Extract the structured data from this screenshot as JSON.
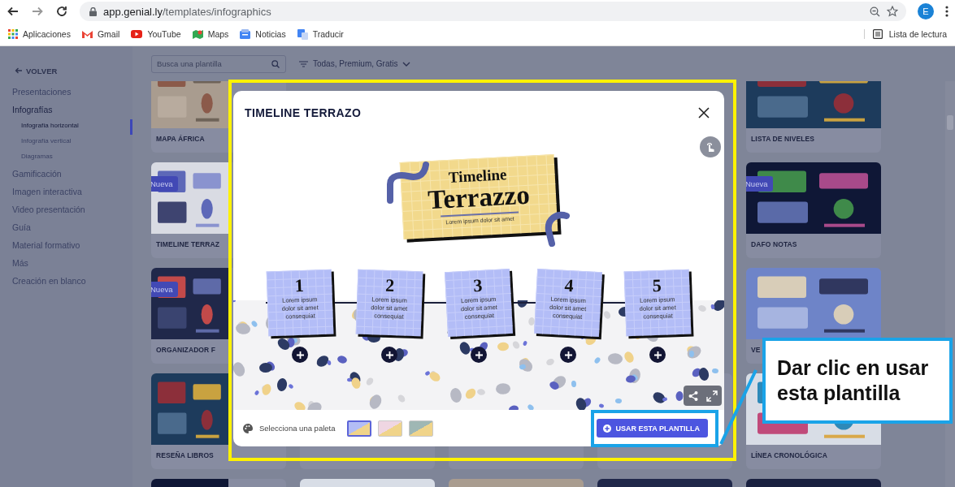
{
  "browser": {
    "url_host": "app.genial.ly",
    "url_path": "/templates/infographics",
    "avatar": "E",
    "bookmarks": [
      {
        "label": "Aplicaciones",
        "kind": "apps"
      },
      {
        "label": "Gmail",
        "kind": "gmail"
      },
      {
        "label": "YouTube",
        "kind": "youtube"
      },
      {
        "label": "Maps",
        "kind": "maps"
      },
      {
        "label": "Noticias",
        "kind": "news"
      },
      {
        "label": "Traducir",
        "kind": "translate"
      }
    ],
    "reading_list": "Lista de lectura"
  },
  "sidebar": {
    "back": "VOLVER",
    "items": [
      {
        "label": "Presentaciones",
        "selected": false
      },
      {
        "label": "Infografías",
        "selected": true,
        "children": [
          {
            "label": "Infografía horizontal",
            "selected": true
          },
          {
            "label": "Infografía vertical",
            "selected": false
          },
          {
            "label": "Diagramas",
            "selected": false
          }
        ]
      },
      {
        "label": "Gamificación",
        "selected": false
      },
      {
        "label": "Imagen interactiva",
        "selected": false
      },
      {
        "label": "Video presentación",
        "selected": false
      },
      {
        "label": "Guía",
        "selected": false
      },
      {
        "label": "Material formativo",
        "selected": false
      },
      {
        "label": "Más",
        "selected": false
      },
      {
        "label": "Creación en blanco",
        "selected": false
      }
    ]
  },
  "toolbar": {
    "search_placeholder": "Busca una plantilla",
    "filter": "Todas, Premium, Gratis"
  },
  "gallery": {
    "columns": [
      {
        "cards": [
          {
            "kind": "template",
            "title": "MAPA ÁFRICA"
          },
          {
            "kind": "template",
            "title": "TIMELINE TERRAZ",
            "badge": "Nueva"
          },
          {
            "kind": "template",
            "title": "ORGANIZADOR F",
            "badge": "Nueva"
          },
          {
            "kind": "template",
            "title": "RESEÑA LIBROS"
          },
          {
            "kind": "thumbnail"
          }
        ]
      },
      {
        "cards": [
          {
            "kind": "blank"
          },
          {
            "kind": "thumbnail"
          }
        ]
      },
      {
        "cards": [
          {
            "kind": "blank"
          },
          {
            "kind": "thumbnail"
          }
        ]
      },
      {
        "cards": [
          {
            "kind": "blank"
          },
          {
            "kind": "thumbnail"
          }
        ]
      },
      {
        "cards": [
          {
            "kind": "template",
            "title": "LISTA DE NIVELES"
          },
          {
            "kind": "template",
            "title": "DAFO NOTAS",
            "badge": "Nueva"
          },
          {
            "kind": "template",
            "title": "VE"
          },
          {
            "kind": "template",
            "title": "LÍNEA CRONOLÓGICA"
          },
          {
            "kind": "thumbnail"
          }
        ]
      }
    ]
  },
  "modal": {
    "title": "TIMELINE TERRAZO",
    "preview": {
      "heading_small": "Timeline",
      "heading_large": "Terrazzo",
      "subtitle": "Lorem ipsum dolor sit amet",
      "steps": [
        {
          "number": "1",
          "text": "Lorem ipsum dolor sit amet consequiat"
        },
        {
          "number": "2",
          "text": "Lorem ipsum dolor sit amet consequiat"
        },
        {
          "number": "3",
          "text": "Lorem ipsum dolor sit amet consequiat"
        },
        {
          "number": "4",
          "text": "Lorem ipsum dolor sit amet consequiat"
        },
        {
          "number": "5",
          "text": "Lorem ipsum dolor sit amet consequiat"
        }
      ]
    },
    "palette_label": "Selecciona una paleta",
    "palettes": [
      {
        "selected": true,
        "color": "#b3bdf5"
      },
      {
        "selected": false,
        "color": "#efd6e2"
      },
      {
        "selected": false,
        "color": "#9fb7b4"
      }
    ],
    "use_button": "USAR ESTA PLANTILLA"
  },
  "annotation": {
    "text": "Dar clic en usar esta plantilla"
  }
}
